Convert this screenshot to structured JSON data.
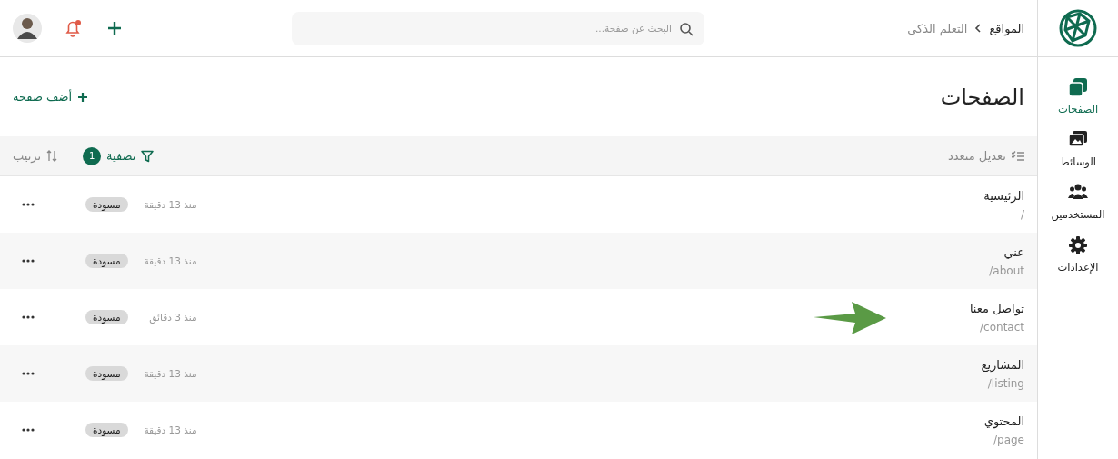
{
  "sidebar": {
    "items": [
      {
        "label": "الصفحات",
        "kind": "pages",
        "selected": true
      },
      {
        "label": "الوسائط",
        "kind": "media",
        "selected": false
      },
      {
        "label": "المستخدمين",
        "kind": "users",
        "selected": false
      },
      {
        "label": "الإعدادات",
        "kind": "settings",
        "selected": false
      }
    ]
  },
  "topbar": {
    "breadcrumb": [
      "المواقع",
      "التعلم الذكي"
    ],
    "search": {
      "placeholder": "البحث عن صفحة..."
    },
    "notifications": {
      "unread": true
    }
  },
  "page_header": {
    "title": "الصفحات",
    "add_button": "أضف صفحة"
  },
  "toolbar": {
    "bulk_edit": "تعديل متعدد",
    "filter": {
      "label": "تصفية",
      "count": "1"
    },
    "sort": "ترتيب"
  },
  "pages": [
    {
      "title": "الرئيسية",
      "slug": "/",
      "updated": "منذ 13 دقيقة",
      "status": "مسودة",
      "pointed": false
    },
    {
      "title": "عني",
      "slug": "/about",
      "updated": "منذ 13 دقيقة",
      "status": "مسودة",
      "pointed": false
    },
    {
      "title": "تواصل معنا",
      "slug": "/contact",
      "updated": "منذ 3 دقائق",
      "status": "مسودة",
      "pointed": true
    },
    {
      "title": "المشاريع",
      "slug": "/listing",
      "updated": "منذ 13 دقيقة",
      "status": "مسودة",
      "pointed": false
    },
    {
      "title": "المحتوي",
      "slug": "/page",
      "updated": "منذ 13 دقيقة",
      "status": "مسودة",
      "pointed": false
    }
  ]
}
